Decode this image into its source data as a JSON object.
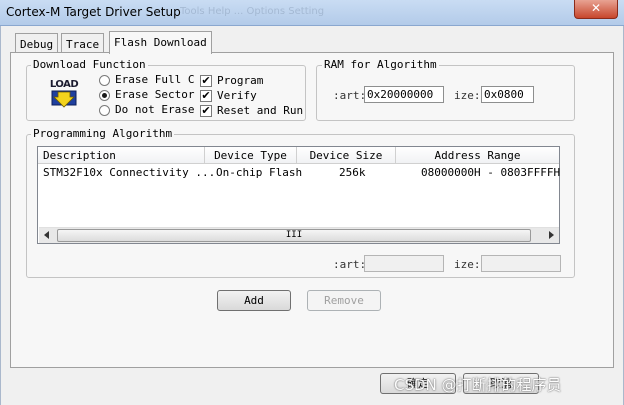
{
  "window": {
    "title": "Cortex-M Target Driver Setup",
    "close_glyph": "✕",
    "bg_menu_ghost": "Tools  Help  ...  Options  Setting"
  },
  "tabs": [
    {
      "label": "Debug",
      "active": false
    },
    {
      "label": "Trace",
      "active": false
    },
    {
      "label": "Flash Download",
      "active": true
    }
  ],
  "download_function": {
    "title": "Download Function",
    "icon": "load-icon",
    "icon_text": "LOAD",
    "erase_options": [
      {
        "label": "Erase Full C",
        "checked": false
      },
      {
        "label": "Erase Sector",
        "checked": true
      },
      {
        "label": "Do not Erase",
        "checked": false
      }
    ],
    "actions": [
      {
        "label": "Program",
        "checked": true
      },
      {
        "label": "Verify",
        "checked": true
      },
      {
        "label": "Reset and Run",
        "checked": true
      }
    ]
  },
  "ram_for_algorithm": {
    "title": "RAM for Algorithm",
    "start_label": ":art:",
    "start_value": "0x20000000",
    "size_label": "ize:",
    "size_value": "0x0800"
  },
  "programming_algorithm": {
    "title": "Programming Algorithm",
    "columns": [
      "Description",
      "Device Type",
      "Device Size",
      "Address Range"
    ],
    "rows": [
      {
        "description": "STM32F10x Connectivity ...",
        "device_type": "On-chip Flash",
        "device_size": "256k",
        "address_range": "08000000H - 0803FFFFH"
      }
    ],
    "scroll_grip": "III",
    "start_label": ":art:",
    "start_value": "",
    "size_label": "ize:",
    "size_value": ""
  },
  "buttons": {
    "add": "Add",
    "remove": "Remove",
    "ok": "确定",
    "cancel": "取消"
  },
  "watermark": "CSDN @打断排的程序员",
  "check_glyph": "✔"
}
